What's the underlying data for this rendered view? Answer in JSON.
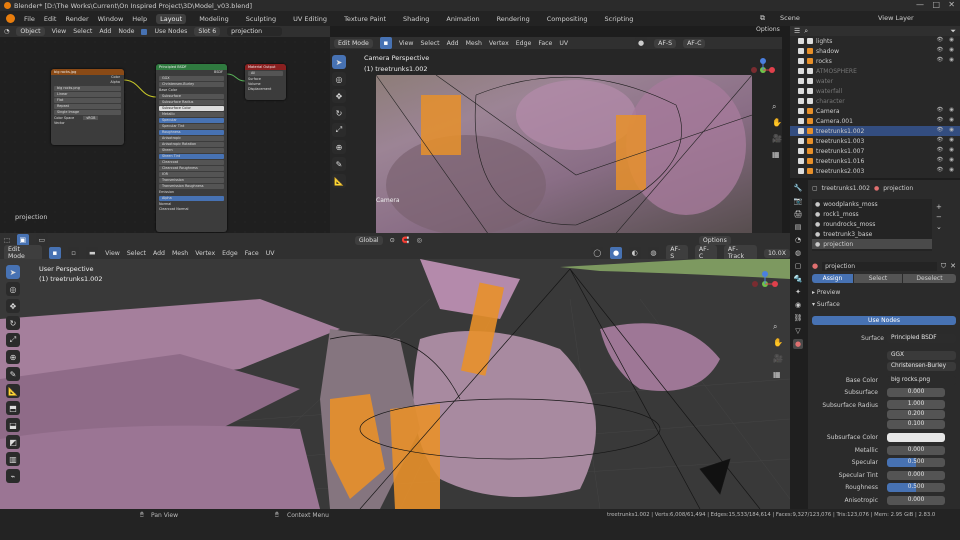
{
  "title": "Blender* [D:\\The Works\\Current\\On Inspired Project\\3D\\Model_v03.blend]",
  "window_controls": {
    "minimize": "—",
    "maximize": "□",
    "close": "✕"
  },
  "menu": [
    "File",
    "Edit",
    "Render",
    "Window",
    "Help"
  ],
  "workspaces": [
    "Layout",
    "Modeling",
    "Sculpting",
    "UV Editing",
    "Texture Paint",
    "Shading",
    "Animation",
    "Rendering",
    "Compositing",
    "Scripting"
  ],
  "active_workspace": "Layout",
  "scene": "Scene",
  "view_layer": "View Layer",
  "node_editor": {
    "type": "Object",
    "menus": [
      "View",
      "Select",
      "Add",
      "Node"
    ],
    "use_nodes": "Use Nodes",
    "slot": "Slot 6",
    "material": "projection",
    "label": "projection",
    "image_node": {
      "title": "big rocks.jpg",
      "rows": [
        "Color",
        "Alpha",
        "big rocks.png",
        "Linear",
        "Flat",
        "Repeat",
        "Single Image",
        "Color Space",
        "sRGB",
        "Vector"
      ]
    },
    "bsdf_node": {
      "title": "Principled BSDF",
      "rows": [
        "BSDF",
        "GGX",
        "Christensen-Burley",
        "Base Color",
        "Subsurface",
        "Subsurface Radius",
        "Subsurface Color",
        "Metallic",
        "Specular",
        "Specular Tint",
        "Roughness",
        "Anisotropic",
        "Anisotropic Rotation",
        "Sheen",
        "Sheen Tint",
        "Clearcoat",
        "Clearcoat Roughness",
        "IOR",
        "Transmission",
        "Transmission Roughness",
        "Emission",
        "Alpha",
        "Normal",
        "Clearcoat Normal"
      ]
    },
    "output_node": {
      "title": "Material Output",
      "rows": [
        "All",
        "Surface",
        "Volume",
        "Displacement"
      ]
    }
  },
  "camera_view": {
    "mode": "Edit Mode",
    "menus": [
      "View",
      "Select",
      "Add",
      "Mesh",
      "Vertex",
      "Edge",
      "Face",
      "UV"
    ],
    "overlay_title": "Camera Perspective",
    "overlay_sub": "(1) treetrunks1.002",
    "bottom_label": "Camera",
    "options": "Options",
    "af_s": "AF-S",
    "af_c": "AF-C"
  },
  "main_view": {
    "mode": "Edit Mode",
    "menus": [
      "View",
      "Select",
      "Add",
      "Mesh",
      "Vertex",
      "Edge",
      "Face",
      "UV"
    ],
    "overlay_title": "User Perspective",
    "overlay_sub": "(1) treetrunks1.002",
    "orientation": "Global",
    "af_s": "AF-S",
    "af_c": "AF-C",
    "af_track": "AF-Track",
    "zoom": "10.0X",
    "options": "Options"
  },
  "outliner": [
    {
      "name": "lights",
      "icon": "collection-icon",
      "sel": false,
      "vis": "👁 ◉"
    },
    {
      "name": "shadow",
      "icon": "mesh-icon",
      "sel": false,
      "vis": "👁 ◉"
    },
    {
      "name": "rocks",
      "icon": "mesh-icon",
      "sel": false,
      "vis": "👁 ◉"
    },
    {
      "name": "ATMOSPHERE",
      "icon": "collection-icon",
      "sel": false,
      "vis": ""
    },
    {
      "name": "water",
      "icon": "collection-icon",
      "sel": false,
      "vis": ""
    },
    {
      "name": "waterfall",
      "icon": "collection-icon",
      "sel": false,
      "vis": ""
    },
    {
      "name": "character",
      "icon": "collection-icon",
      "sel": false,
      "vis": ""
    },
    {
      "name": "Camera",
      "icon": "camera-icon",
      "sel": false,
      "vis": "👁 ◉"
    },
    {
      "name": "Camera.001",
      "icon": "camera-icon",
      "sel": false,
      "vis": "👁 ◉"
    },
    {
      "name": "treetrunks1.002",
      "icon": "mesh-icon",
      "sel": true,
      "vis": "👁 ◉"
    },
    {
      "name": "treetrunks1.003",
      "icon": "mesh-icon",
      "sel": false,
      "vis": "👁 ◉"
    },
    {
      "name": "treetrunks1.007",
      "icon": "mesh-icon",
      "sel": false,
      "vis": "👁 ◉"
    },
    {
      "name": "treetrunks1.016",
      "icon": "mesh-icon",
      "sel": false,
      "vis": "👁 ◉"
    },
    {
      "name": "treetrunks2.003",
      "icon": "mesh-icon",
      "sel": false,
      "vis": "👁 ◉"
    }
  ],
  "properties": {
    "object": "treetrunks1.002",
    "material_tab": "projection",
    "slots": [
      "woodplanks_moss",
      "rock1_moss",
      "roundrocks_moss",
      "treetrunk3_base",
      "projection"
    ],
    "material_name": "projection",
    "assign": "Assign",
    "select": "Select",
    "deselect": "Deselect",
    "preview": "Preview",
    "surface_panel": "Surface",
    "use_nodes": "Use Nodes",
    "fields": {
      "surface_label": "Surface",
      "surface_value": "Principled BSDF",
      "dist": "GGX",
      "sss_method": "Christensen-Burley",
      "base_color_label": "Base Color",
      "base_color_value": "big rocks.png",
      "subsurface_label": "Subsurface",
      "subsurface_value": "0.000",
      "ssr_label": "Subsurface Radius",
      "ssr_1": "1.000",
      "ssr_2": "0.200",
      "ssr_3": "0.100",
      "ssc_label": "Subsurface Color",
      "metallic_label": "Metallic",
      "metallic_value": "0.000",
      "specular_label": "Specular",
      "specular_value": "0.500",
      "spec_tint_label": "Specular Tint",
      "spec_tint_value": "0.000",
      "roughness_label": "Roughness",
      "roughness_value": "0.500",
      "aniso_label": "Anisotropic",
      "aniso_value": "0.000"
    }
  },
  "status": {
    "pan": "Pan View",
    "context": "Context Menu",
    "stats": "treetrunks1.002 | Verts:6,008/61,494 | Edges:15,533/184,614 | Faces:9,327/123,076 | Tris:123,076 | Mem: 2.95 GiB | 2.83.0"
  },
  "colors": {
    "accent": "#4772b3",
    "selection_orange": "#e8902a",
    "mesh_pink": "#b08aa6"
  }
}
